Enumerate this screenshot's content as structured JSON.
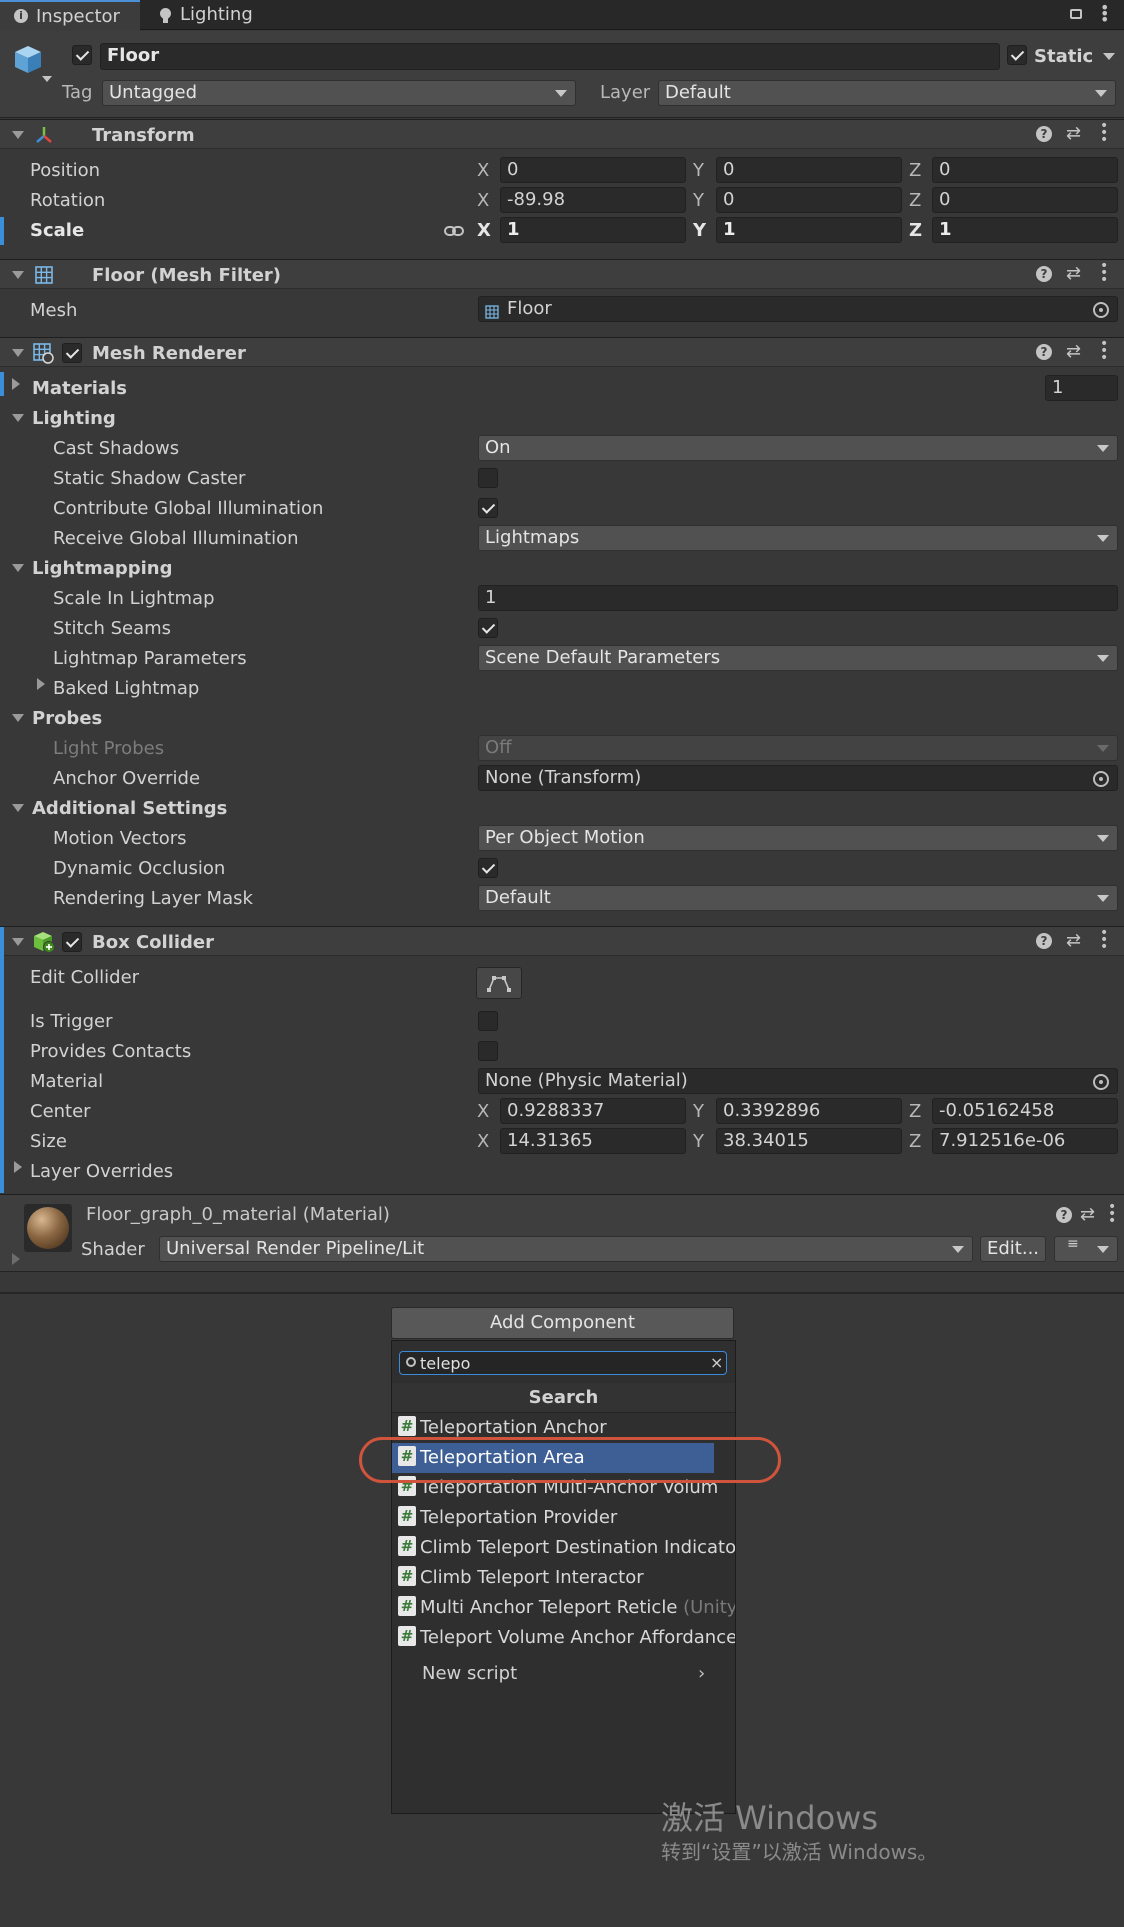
{
  "tabs": [
    {
      "label": "Inspector",
      "icon": "info-icon"
    },
    {
      "label": "Lighting",
      "icon": "lightbulb-icon"
    }
  ],
  "object": {
    "name": "Floor",
    "active": true,
    "static_label": "Static",
    "static": true,
    "tag_label": "Tag",
    "tag_value": "Untagged",
    "layer_label": "Layer",
    "layer_value": "Default"
  },
  "transform": {
    "title": "Transform",
    "rows": [
      {
        "label": "Position",
        "x": "0",
        "y": "0",
        "z": "0"
      },
      {
        "label": "Rotation",
        "x": "-89.98",
        "y": "0",
        "z": "0"
      },
      {
        "label": "Scale",
        "x": "1",
        "y": "1",
        "z": "1"
      }
    ],
    "axis": {
      "x": "X",
      "y": "Y",
      "z": "Z"
    }
  },
  "mesh_filter": {
    "title": "Floor (Mesh Filter)",
    "mesh_label": "Mesh",
    "mesh_value": "Floor"
  },
  "mesh_renderer": {
    "title": "Mesh Renderer",
    "enabled": true,
    "materials_label": "Materials",
    "materials_count": "1",
    "lighting_label": "Lighting",
    "cast_shadows_label": "Cast Shadows",
    "cast_shadows_value": "On",
    "static_shadow_label": "Static Shadow Caster",
    "static_shadow": false,
    "contribute_gi_label": "Contribute Global Illumination",
    "contribute_gi": true,
    "receive_gi_label": "Receive Global Illumination",
    "receive_gi_value": "Lightmaps",
    "lightmapping_label": "Lightmapping",
    "scale_lightmap_label": "Scale In Lightmap",
    "scale_lightmap_value": "1",
    "stitch_seams_label": "Stitch Seams",
    "stitch_seams": true,
    "lightmap_params_label": "Lightmap Parameters",
    "lightmap_params_value": "Scene Default Parameters",
    "baked_lightmap_label": "Baked Lightmap",
    "probes_label": "Probes",
    "light_probes_label": "Light Probes",
    "light_probes_value": "Off",
    "anchor_override_label": "Anchor Override",
    "anchor_override_value": "None (Transform)",
    "additional_label": "Additional Settings",
    "motion_vectors_label": "Motion Vectors",
    "motion_vectors_value": "Per Object Motion",
    "dynamic_occlusion_label": "Dynamic Occlusion",
    "dynamic_occlusion": true,
    "rendering_layer_label": "Rendering Layer Mask",
    "rendering_layer_value": "Default"
  },
  "box_collider": {
    "title": "Box Collider",
    "enabled": true,
    "edit_collider_label": "Edit Collider",
    "is_trigger_label": "Is Trigger",
    "is_trigger": false,
    "provides_contacts_label": "Provides Contacts",
    "provides_contacts": false,
    "material_label": "Material",
    "material_value": "None (Physic Material)",
    "center_label": "Center",
    "center": {
      "x": "0.9288337",
      "y": "0.3392896",
      "z": "-0.05162458"
    },
    "size_label": "Size",
    "size": {
      "x": "14.31365",
      "y": "38.34015",
      "z": "7.912516e-06"
    },
    "layer_overrides_label": "Layer Overrides"
  },
  "material": {
    "title": "Floor_graph_0_material (Material)",
    "shader_label": "Shader",
    "shader_value": "Universal Render Pipeline/Lit",
    "edit_label": "Edit..."
  },
  "add_component": {
    "button_label": "Add Component",
    "search_value": "telepo",
    "search_header": "Search",
    "results": [
      {
        "label": "Teleportation Anchor",
        "suffix": "",
        "selected": false
      },
      {
        "label": "Teleportation Area",
        "suffix": "",
        "selected": true
      },
      {
        "label": "Teleportation Multi-Anchor Volum",
        "suffix": "",
        "selected": false
      },
      {
        "label": "Teleportation Provider",
        "suffix": "",
        "selected": false
      },
      {
        "label": "Climb Teleport Destination Indicator",
        "suffix": "",
        "selected": false
      },
      {
        "label": "Climb Teleport Interactor",
        "suffix": "",
        "selected": false
      },
      {
        "label": "Multi Anchor Teleport Reticle",
        "suffix": " (Unity",
        "selected": false
      },
      {
        "label": "Teleport Volume Anchor Affordance",
        "suffix": "",
        "selected": false
      }
    ],
    "new_script_label": "New script"
  },
  "watermark": {
    "line1": "激活 Windows",
    "line2": "转到“设置”以激活 Windows。"
  },
  "colors": {
    "selection": "#3e5f96",
    "annotation": "#d0543c",
    "accent": "#3a8fd8"
  }
}
